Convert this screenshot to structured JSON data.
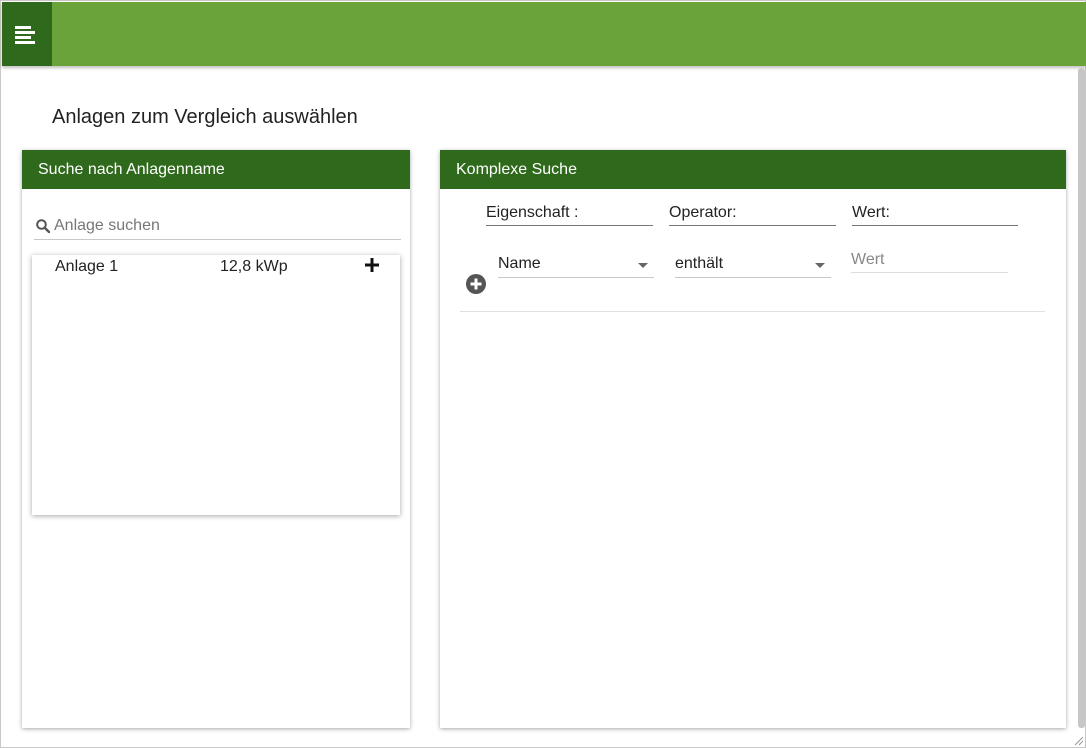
{
  "header": {
    "menu_icon": "menu-icon",
    "accent_color": "#6aa33a",
    "dark_color": "#2f6a1c"
  },
  "page": {
    "title": "Anlagen zum Vergleich auswählen"
  },
  "name_search": {
    "header": "Suche nach Anlagenname",
    "search_placeholder": "Anlage suchen",
    "search_icon": "search-icon",
    "results": [
      {
        "name": "Anlage 1",
        "power": "12,8 kWp",
        "action_icon": "plus-icon"
      }
    ]
  },
  "complex_search": {
    "header": "Komplexe Suche",
    "columns": {
      "property": "Eigenschaft :",
      "operator": "Operator:",
      "value": "Wert:"
    },
    "rows": [
      {
        "property": "Name",
        "operator": "enthält",
        "value_placeholder": "Wert"
      }
    ],
    "add_icon": "plus-circle-icon"
  }
}
